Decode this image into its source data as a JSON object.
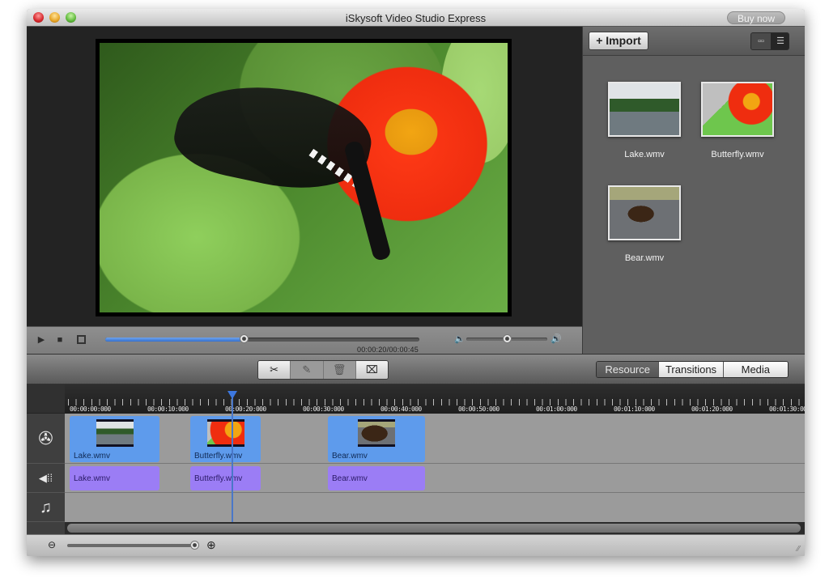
{
  "window": {
    "title": "iSkysoft Video Studio Express",
    "buy_now_label": "Buy now"
  },
  "player": {
    "timecode": "00:00:20/00:00:45",
    "progress_fraction": 0.44,
    "volume_fraction": 0.5,
    "icons": {
      "play": "play-icon",
      "stop": "stop-icon",
      "fullscreen": "fullscreen-icon",
      "volume_low": "volume-low-icon",
      "volume_high": "volume-high-icon"
    }
  },
  "resource_panel": {
    "import_label": "+ Import",
    "view_modes": [
      "grid",
      "list"
    ],
    "selected_view": "list",
    "items": [
      {
        "name": "Lake.wmv"
      },
      {
        "name": "Butterfly.wmv"
      },
      {
        "name": "Bear.wmv"
      }
    ]
  },
  "edit_toolbar": {
    "tools": [
      {
        "name": "split",
        "glyph": "✂"
      },
      {
        "name": "edit",
        "glyph": "✎"
      },
      {
        "name": "delete",
        "glyph": "🗑"
      },
      {
        "name": "crop",
        "glyph": "⌧"
      }
    ],
    "tabs": [
      {
        "label": "Resource",
        "active": true
      },
      {
        "label": "Transitions",
        "active": false
      },
      {
        "label": "Media",
        "active": false
      }
    ]
  },
  "timeline": {
    "ruler_labels": [
      "00:00:00:000",
      "00:00:10:000",
      "00:00:20:000",
      "00:00:30:000",
      "00:00:40:000",
      "00:00:50:000",
      "00:01:00:000",
      "00:01:10:000",
      "00:01:20:000",
      "00:01:30:000"
    ],
    "tracks": {
      "video": {
        "icon": "film-reel-icon",
        "clips": [
          {
            "label": "Lake.wmv"
          },
          {
            "label": "Butterfly.wmv"
          },
          {
            "label": "Bear.wmv"
          }
        ]
      },
      "audio": {
        "icon": "audio-wave-icon",
        "clips": [
          {
            "label": "Lake.wmv"
          },
          {
            "label": "Butterfly.wmv"
          },
          {
            "label": "Bear.wmv"
          }
        ]
      },
      "music": {
        "icon": "music-note-icon",
        "clips": []
      }
    },
    "playhead_time": "00:00:20",
    "zoom_fraction": 1.0
  },
  "colors": {
    "video_clip": "#5e9bec",
    "audio_clip": "#9b7df5",
    "progress": "#3d78e0"
  }
}
